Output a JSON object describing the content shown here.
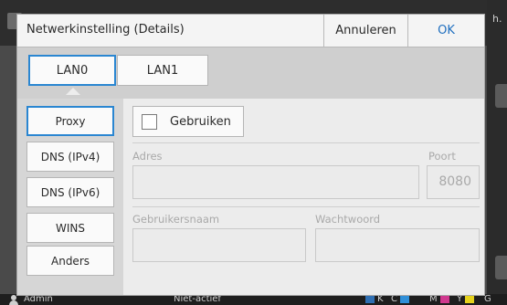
{
  "dialog": {
    "title": "Netwerkinstelling (Details)",
    "cancel_label": "Annuleren",
    "ok_label": "OK"
  },
  "lan_tabs": [
    {
      "label": "LAN0",
      "selected": true
    },
    {
      "label": "LAN1",
      "selected": false
    }
  ],
  "side_menu": [
    {
      "label": "Proxy",
      "selected": true
    },
    {
      "label": "DNS (IPv4)",
      "selected": false
    },
    {
      "label": "DNS (IPv6)",
      "selected": false
    },
    {
      "label": "WINS",
      "selected": false
    },
    {
      "label": "Anders",
      "selected": false
    }
  ],
  "proxy": {
    "use_label": "Gebruiken",
    "use_checked": false,
    "address_label": "Adres",
    "address_value": "",
    "port_label": "Poort",
    "port_value": "8080",
    "username_label": "Gebruikersnaam",
    "username_value": "",
    "password_label": "Wachtwoord",
    "password_value": ""
  },
  "status_bar": {
    "user": "Admin",
    "state": "Niet-actief",
    "ink_labels": [
      "K",
      "C",
      "M",
      "Y",
      "G"
    ]
  },
  "background": {
    "right_fragment": "h."
  },
  "colors": {
    "accent": "#2a86d1",
    "ok_text": "#1f6fbf",
    "ink_k": "#6a6a6a",
    "ink_c": "#2f8fd8",
    "ink_m": "#d0388e",
    "ink_y": "#e6d21c",
    "ink_g": "#8a8a8a"
  }
}
